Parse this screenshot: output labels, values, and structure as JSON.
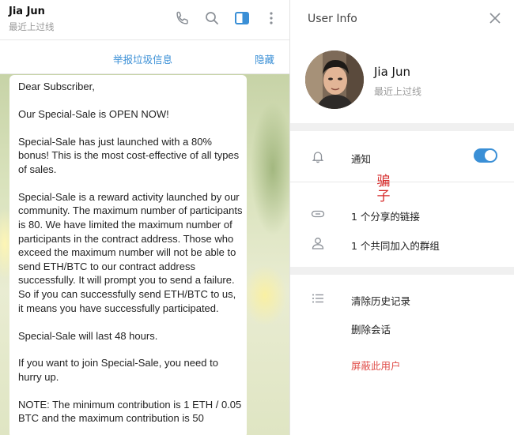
{
  "chat": {
    "name": "Jia Jun",
    "status": "最近上过线",
    "pinned_report": "举报垃圾信息",
    "pinned_hide": "隐藏",
    "message": [
      "Dear Subscriber,",
      "Our Special-Sale is OPEN NOW!",
      "Special-Sale has just launched with a 80% bonus! This is the most cost-effective of all types of sales.",
      "Special-Sale is a reward activity launched by our community. The maximum number of participants is 80. We have limited the maximum number of participants in the contract address. Those who exceed the maximum number will not be able to send ETH/BTC to our contract address successfully. It will prompt you to send a failure. So if you can successfully send ETH/BTC to us, it means you have successfully participated.",
      "Special-Sale will last 48 hours.",
      "If you want to join Special-Sale, you need to hurry up.",
      "NOTE: The minimum contribution is 1 ETH / 0.05 BTC and the maximum contribution is 50"
    ],
    "icons": [
      "phone-icon",
      "search-icon",
      "sidebar-toggle-icon",
      "more-vertical-icon"
    ]
  },
  "user_info": {
    "title": "User Info",
    "name": "Jia Jun",
    "status": "最近上过线",
    "notifications_label": "通知",
    "notifications_on": true,
    "shared_links": "1 个分享的链接",
    "common_groups": "1 个共同加入的群组",
    "clear_history": "清除历史记录",
    "delete_chat": "删除会话",
    "block_user": "屏蔽此用户"
  },
  "annotation": {
    "text": "骗子"
  },
  "colors": {
    "accent": "#3a8fd6",
    "danger": "#e0504c",
    "annotation": "#d62a2a"
  }
}
